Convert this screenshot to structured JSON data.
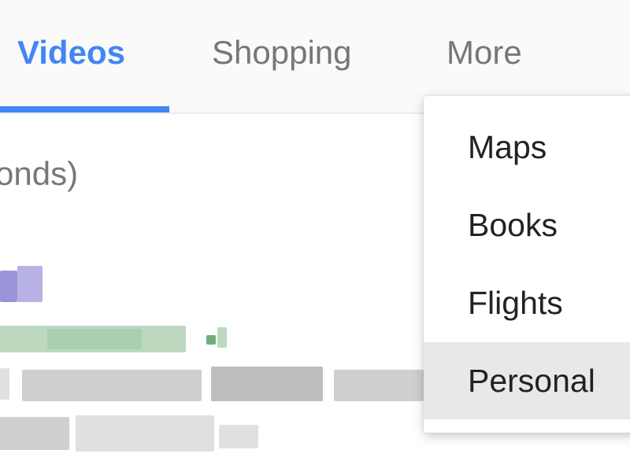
{
  "tabs": {
    "videos": "Videos",
    "shopping": "Shopping",
    "more": "More"
  },
  "result_stats_fragment": "onds)",
  "more_menu": {
    "items": [
      "Maps",
      "Books",
      "Flights",
      "Personal"
    ],
    "highlighted": "Personal"
  },
  "colors": {
    "active_tab": "#4285f4",
    "inactive_tab": "#777777",
    "menu_text": "#222222",
    "menu_highlight": "#e8e8e8"
  }
}
